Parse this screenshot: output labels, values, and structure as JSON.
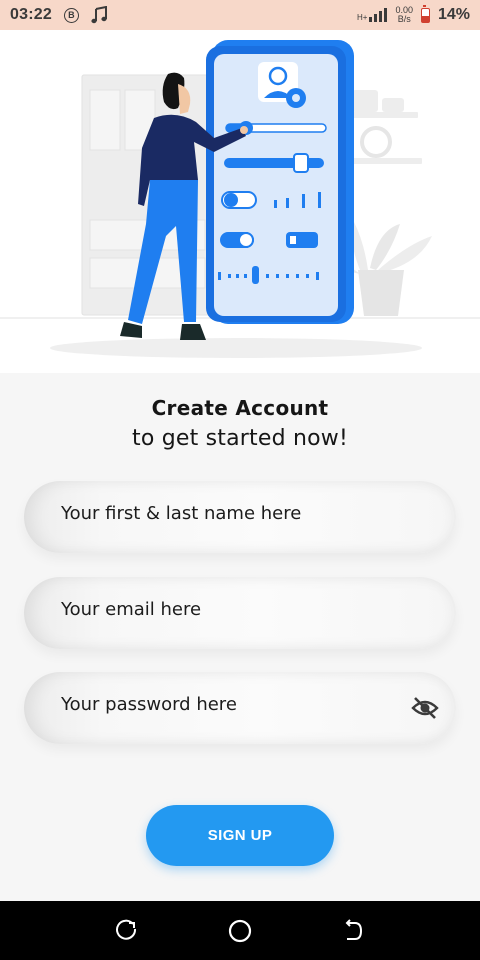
{
  "status_bar": {
    "time": "03:22",
    "b_badge": "B",
    "network_type": "H+",
    "speed_value": "0.00",
    "speed_unit": "B/s",
    "battery_percent": "14%"
  },
  "illustration": {
    "subject": "woman adjusting settings on a large phone"
  },
  "heading": {
    "title": "Create Account",
    "subtitle": "to get started now!"
  },
  "form": {
    "name_placeholder": "Your first & last name here",
    "email_placeholder": "Your email here",
    "password_placeholder": "Your password here"
  },
  "signup_label": "SIGN UP",
  "colors": {
    "accent": "#2399f1",
    "status_bar": "#f7d8c9",
    "illustration_blue": "#1f7ef0",
    "navy": "#1a2a63"
  },
  "icons": {
    "music": "music-note-icon",
    "battery": "battery-icon",
    "signal": "signal-icon",
    "eye": "eye-off-icon",
    "recent": "recent-apps-icon",
    "home": "home-icon",
    "back": "back-icon"
  }
}
